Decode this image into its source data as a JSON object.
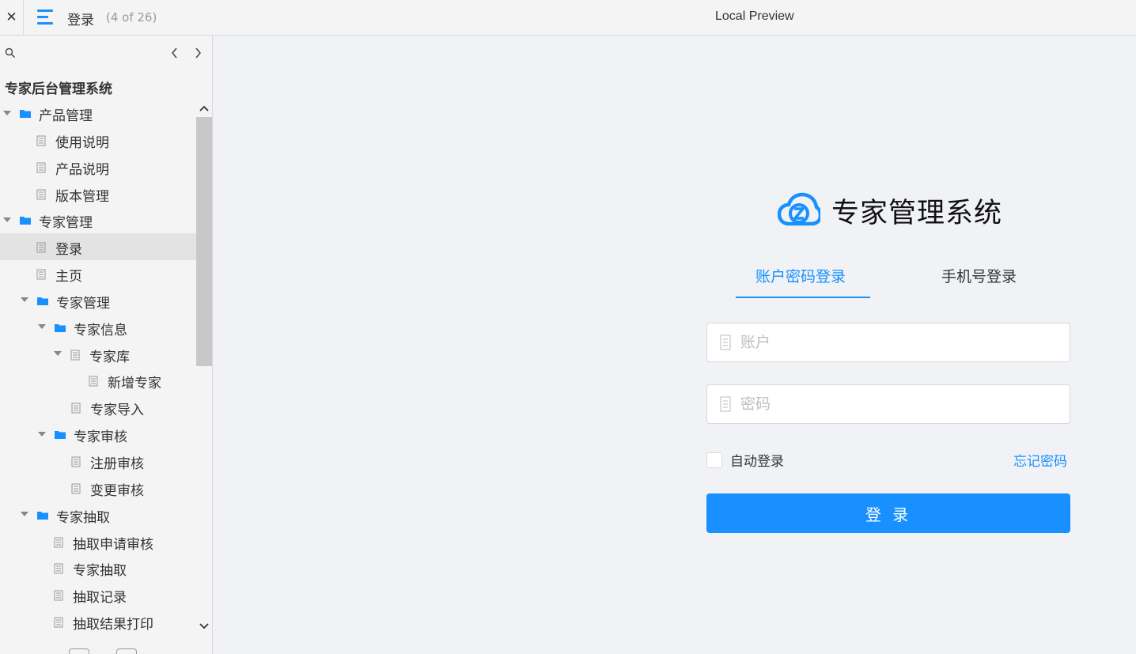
{
  "topbar": {
    "close_label": "✕",
    "current_page": "登录",
    "page_counter": "(4 of 26)",
    "preview_title": "Local Preview",
    "accent_color": "#1890ff"
  },
  "sidebar": {
    "project_title": "专家后台管理系统",
    "tree": [
      {
        "label": "产品管理",
        "type": "folder",
        "level": 0,
        "expanded": true
      },
      {
        "label": "使用说明",
        "type": "page",
        "level": 1
      },
      {
        "label": "产品说明",
        "type": "page",
        "level": 1
      },
      {
        "label": "版本管理",
        "type": "page",
        "level": 1
      },
      {
        "label": "专家管理",
        "type": "folder",
        "level": 0,
        "expanded": true
      },
      {
        "label": "登录",
        "type": "page",
        "level": 1,
        "selected": true
      },
      {
        "label": "主页",
        "type": "page",
        "level": 1
      },
      {
        "label": "专家管理",
        "type": "folder",
        "level": 1,
        "expanded": true
      },
      {
        "label": "专家信息",
        "type": "folder",
        "level": 2,
        "expanded": true
      },
      {
        "label": "专家库",
        "type": "page",
        "level": 3,
        "expanded": true
      },
      {
        "label": "新增专家",
        "type": "page",
        "level": 4
      },
      {
        "label": "专家导入",
        "type": "page",
        "level": 3
      },
      {
        "label": "专家审核",
        "type": "folder",
        "level": 2,
        "expanded": true
      },
      {
        "label": "注册审核",
        "type": "page",
        "level": 3
      },
      {
        "label": "变更审核",
        "type": "page",
        "level": 3
      },
      {
        "label": "专家抽取",
        "type": "folder",
        "level": 1,
        "expanded": true
      },
      {
        "label": "抽取申请审核",
        "type": "page",
        "level": 2
      },
      {
        "label": "专家抽取",
        "type": "page",
        "level": 2
      },
      {
        "label": "抽取记录",
        "type": "page",
        "level": 2
      },
      {
        "label": "抽取结果打印",
        "type": "page",
        "level": 2
      }
    ]
  },
  "main": {
    "brand_name": "专家管理系统",
    "tabs": [
      {
        "label": "账户密码登录",
        "active": true
      },
      {
        "label": "手机号登录",
        "active": false
      }
    ],
    "account_placeholder": "账户",
    "password_placeholder": "密码",
    "remember_label": "自动登录",
    "forgot_label": "忘记密码",
    "submit_label": "登 录",
    "primary_color": "#1890ff"
  }
}
